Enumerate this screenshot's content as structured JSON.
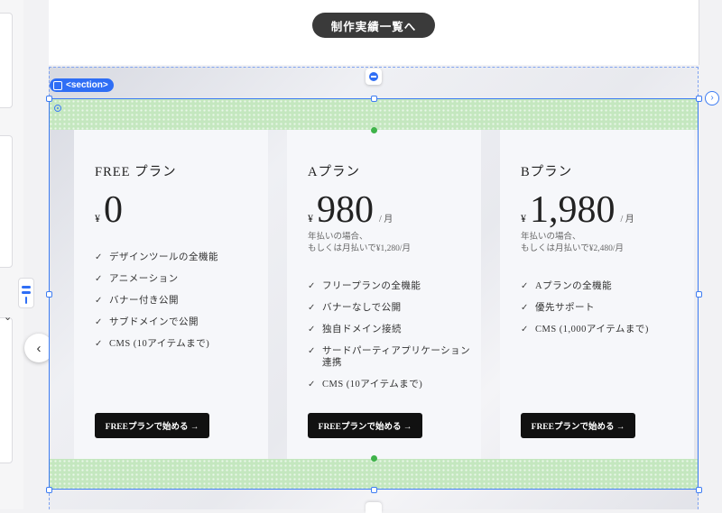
{
  "top": {
    "works_button": "制作実績一覧へ"
  },
  "editor": {
    "section_tag": "<section>",
    "icons": {
      "collapse": "chevron-left-icon",
      "add_section": "add-section-icon",
      "next": "chevron-right-icon",
      "menu": "chevron-down-icon"
    },
    "colors": {
      "accent": "#2f6ef5",
      "padding": "#c4e7bf"
    }
  },
  "plans": [
    {
      "name": "FREE プラン",
      "currency": "¥",
      "price": "0",
      "per": "",
      "note": "",
      "features": [
        "デザインツールの全機能",
        "アニメーション",
        "バナー付き公開",
        "サブドメインで公開",
        "CMS (10アイテムまで)"
      ],
      "cta": "FREEプランで始める →"
    },
    {
      "name": "Aプラン",
      "currency": "¥",
      "price": "980",
      "per": "/ 月",
      "note": "年払いの場合、\nもしくは月払いで¥1,280/月",
      "features": [
        "フリープランの全機能",
        "バナーなしで公開",
        "独自ドメイン接続",
        "サードパーティアプリケーション連携",
        "CMS (10アイテムまで)"
      ],
      "cta": "FREEプランで始める →"
    },
    {
      "name": "Bプラン",
      "currency": "¥",
      "price": "1,980",
      "per": "/ 月",
      "note": "年払いの場合、\nもしくは月払いで¥2,480/月",
      "features": [
        "Aプランの全機能",
        "優先サポート",
        "CMS (1,000アイテムまで)"
      ],
      "cta": "FREEプランで始める →"
    }
  ]
}
